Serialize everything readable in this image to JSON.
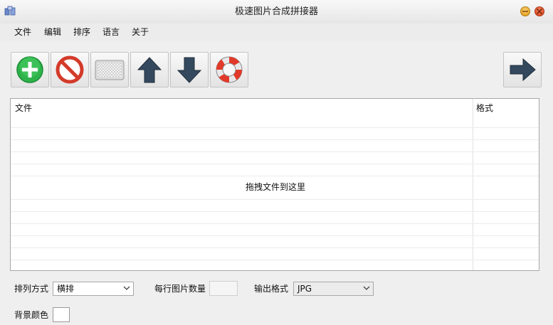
{
  "window": {
    "title": "极速图片合成拼接器"
  },
  "menu": {
    "items": [
      "文件",
      "编辑",
      "排序",
      "语言",
      "关于"
    ]
  },
  "filelist": {
    "columns": [
      "文件",
      "格式"
    ],
    "drop_hint": "拖拽文件到这里"
  },
  "options": {
    "arrange_label": "排列方式",
    "arrange_value": "横排",
    "per_row_label": "每行图片数量",
    "per_row_value": "",
    "output_format_label": "输出格式",
    "output_format_value": "JPG",
    "bg_color_label": "背景颜色",
    "bg_color_value": "#ffffff"
  },
  "toolbar": {
    "icons": [
      "add-icon",
      "remove-icon",
      "clear-icon",
      "move-up-icon",
      "move-down-icon",
      "help-icon",
      "next-icon"
    ]
  }
}
